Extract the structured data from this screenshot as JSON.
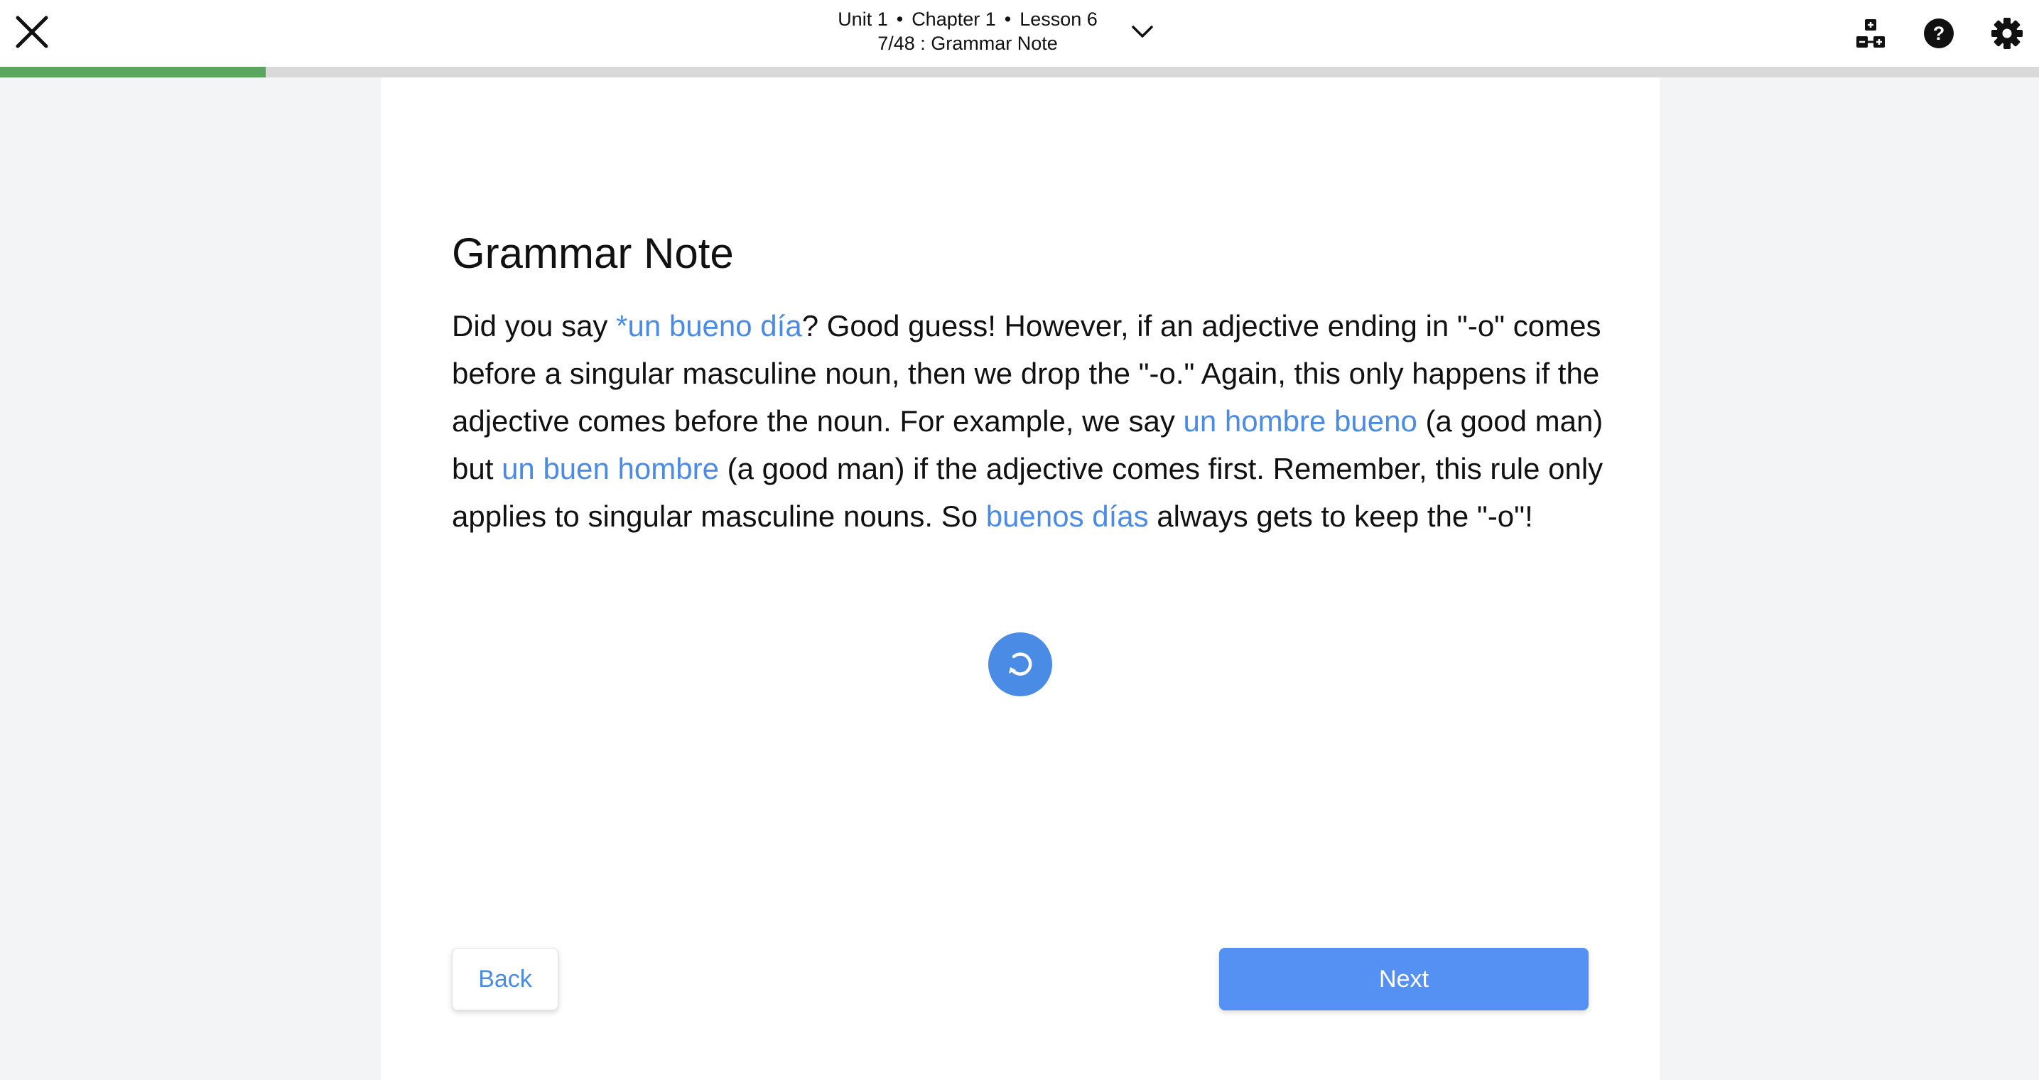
{
  "header": {
    "unit": "Unit 1",
    "chapter": "Chapter 1",
    "lesson": "Lesson 6",
    "separator": "•",
    "position": "7/48 : Grammar Note"
  },
  "icons": {
    "close": "close-icon",
    "dropdown": "chevron-down-icon",
    "chart": "flowchart-icon",
    "help": "question-mark-icon",
    "settings": "gear-icon",
    "replay": "replay-icon"
  },
  "progress": {
    "fraction": 0.1303
  },
  "colors": {
    "accent": "#4a8be6",
    "progress_fill": "#5aa55f",
    "next_button": "#5591f2"
  },
  "content": {
    "title": "Grammar Note",
    "p": [
      "Did you say ",
      "*un bueno día",
      "?  Good guess!  However, if an adjective ending in \"-o\" comes before a singular masculine noun, then we drop the \"-o.\"  Again, this only happens if the adjective comes before the noun.  For example, we say ",
      "un hombre bueno",
      " (a good man) but ",
      "un buen hombre",
      " (a good man) if the adjective comes first.  Remember, this rule only applies to singular masculine nouns.  So ",
      "buenos días",
      " always gets to keep the \"-o\"!"
    ]
  },
  "buttons": {
    "back": "Back",
    "next": "Next"
  }
}
